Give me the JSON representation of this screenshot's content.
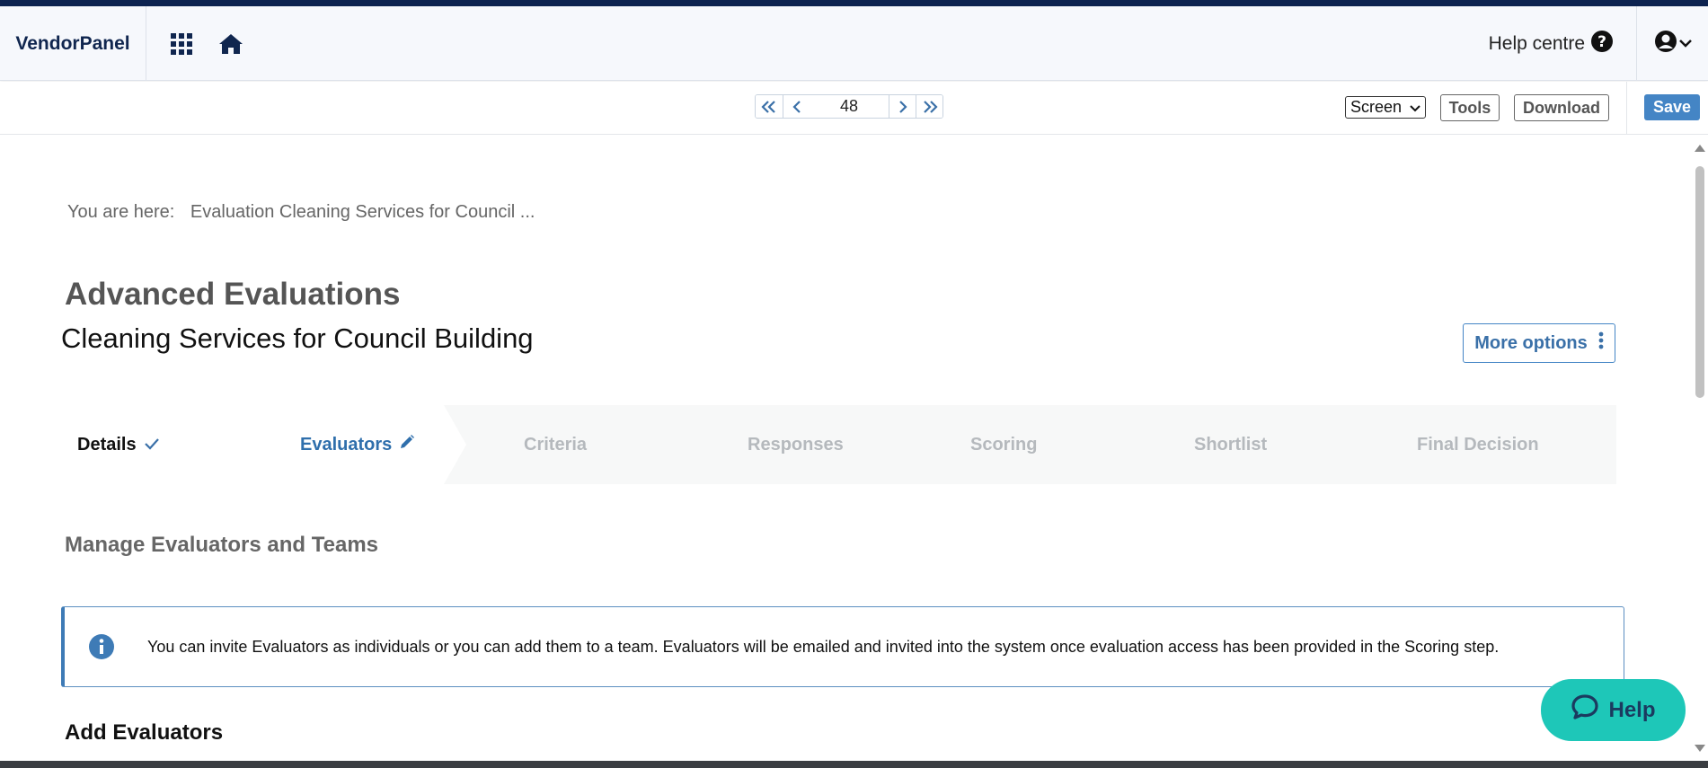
{
  "navbar": {
    "brand": "VendorPanel",
    "help_centre_label": "Help centre",
    "icons": [
      "apps-grid-icon",
      "home-icon",
      "help-question-icon",
      "user-account-icon",
      "chevron-down-icon"
    ]
  },
  "toolbar": {
    "page_number": "48",
    "view_select": "Screen",
    "tools_label": "Tools",
    "download_label": "Download",
    "save_label": "Save"
  },
  "breadcrumb": {
    "prefix": "You are here:",
    "current": "Evaluation Cleaning Services for Council ..."
  },
  "header": {
    "title": "Advanced Evaluations",
    "subtitle": "Cleaning Services for Council Building",
    "more_options_label": "More options"
  },
  "steps": [
    {
      "label": "Details",
      "state": "done"
    },
    {
      "label": "Evaluators",
      "state": "active"
    },
    {
      "label": "Criteria",
      "state": "pending"
    },
    {
      "label": "Responses",
      "state": "pending"
    },
    {
      "label": "Scoring",
      "state": "pending"
    },
    {
      "label": "Shortlist",
      "state": "pending"
    },
    {
      "label": "Final Decision",
      "state": "pending"
    }
  ],
  "main": {
    "section_heading": "Manage Evaluators and Teams",
    "info_text": "You can invite Evaluators as individuals or you can add them to a team. Evaluators will be emailed and invited into the system once evaluation access has been provided in the Scoring step.",
    "add_heading": "Add Evaluators"
  },
  "help_widget": {
    "label": "Help"
  },
  "colors": {
    "navy": "#0d2350",
    "accent": "#4485c5",
    "teal": "#1ec7b8"
  }
}
